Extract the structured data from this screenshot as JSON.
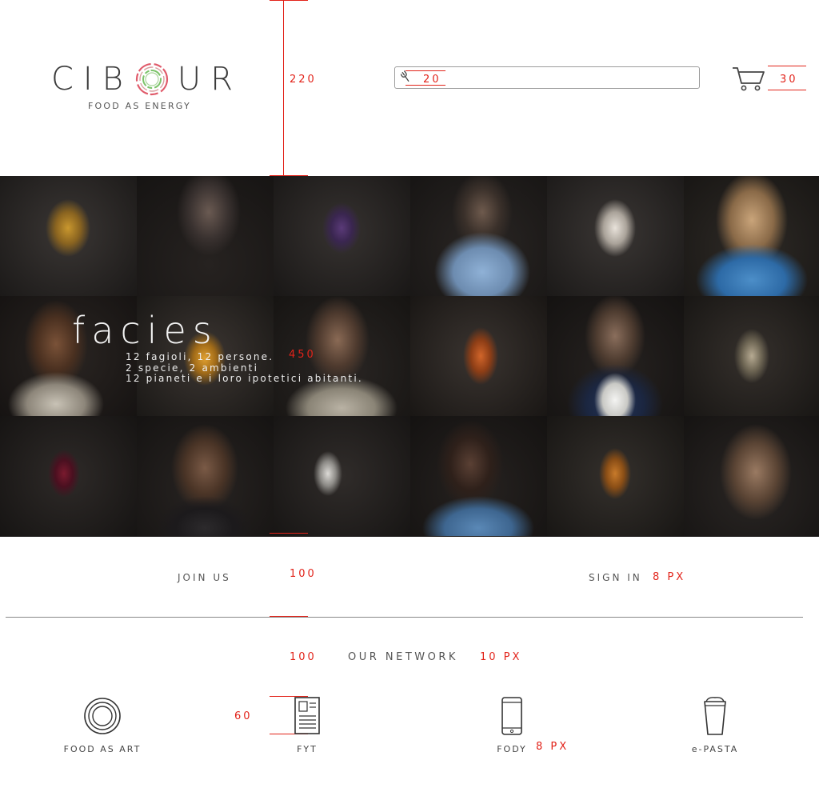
{
  "header": {
    "logo_text_left": "CIB",
    "logo_text_right": "UR",
    "tagline": "FOOD AS ENERGY",
    "search": {
      "value": "",
      "placeholder": ""
    },
    "cart_label": "cart"
  },
  "annotations": {
    "header_height": "220",
    "search_size": "20",
    "cart_size": "30",
    "hero_height": "450",
    "join_section_height": "100",
    "link_spacing": "8 PX",
    "network_section_height": "100",
    "network_spacing": "10 PX",
    "icon_height": "60",
    "fody_spacing": "8 PX"
  },
  "hero": {
    "title": "facies",
    "lines": [
      "12 fagioli, 12 persone.",
      "2 specie, 2 ambienti",
      "12 pianeti e i loro ipotetici abitanti."
    ]
  },
  "account": {
    "join_label": "JOIN US",
    "signin_label": "SIGN IN"
  },
  "network": {
    "title": "OUR NETWORK",
    "items": [
      {
        "label": "FOOD AS ART",
        "icon": "rings-icon"
      },
      {
        "label": "FYT",
        "icon": "document-icon"
      },
      {
        "label": "FODY",
        "icon": "phone-icon"
      },
      {
        "label": "e-PASTA",
        "icon": "cup-icon"
      }
    ]
  },
  "colors": {
    "accent": "#e2231a",
    "text": "#444444",
    "hero_bg": "#1e1c1b"
  }
}
